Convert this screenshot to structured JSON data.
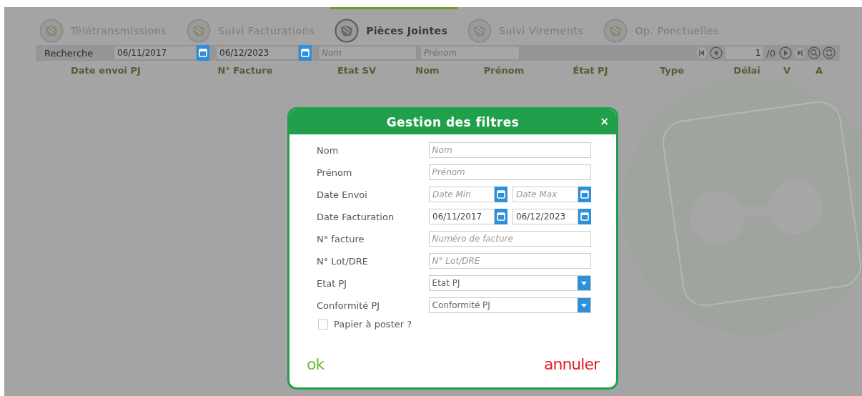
{
  "tabs": [
    {
      "label": "Télétransmissions",
      "selected": false
    },
    {
      "label": "Suivi Facturations",
      "selected": false
    },
    {
      "label": "Pièces Jointes",
      "selected": true
    },
    {
      "label": "Suivi Virements",
      "selected": false
    },
    {
      "label": "Op. Ponctuelles",
      "selected": false
    }
  ],
  "search_bar": {
    "label": "Recherche",
    "date_from": "06/11/2017",
    "date_to": "06/12/2023",
    "name_placeholder": "Nom",
    "firstname_placeholder": "Prénom",
    "page": "1",
    "page_total": "/0"
  },
  "table": {
    "columns": [
      "Date envoi PJ",
      "N° Facture",
      "Etat SV",
      "Nom",
      "Prénom",
      "État PJ",
      "Type",
      "Délai",
      "V",
      "A"
    ]
  },
  "dialog": {
    "title": "Gestion des filtres",
    "close": "×",
    "fields": [
      {
        "kind": "text",
        "label": "Nom",
        "placeholder": "Nom"
      },
      {
        "kind": "text",
        "label": "Prénom",
        "placeholder": "Prénom"
      },
      {
        "kind": "daterange",
        "label": "Date Envoi",
        "from": {
          "placeholder": "Date Min"
        },
        "to": {
          "placeholder": "Date Max"
        }
      },
      {
        "kind": "daterange",
        "label": "Date Facturation",
        "from": {
          "value": "06/11/2017"
        },
        "to": {
          "value": "06/12/2023"
        }
      },
      {
        "kind": "text",
        "label": "N° facture",
        "placeholder": "Numéro de facture"
      },
      {
        "kind": "text",
        "label": "N° Lot/DRE",
        "placeholder": "N° Lot/DRE"
      },
      {
        "kind": "select",
        "label": "Etat PJ",
        "value": "Etat PJ"
      },
      {
        "kind": "select",
        "label": "Conformité PJ",
        "value": "Conformité PJ"
      }
    ],
    "checkbox": {
      "label": "Papier à poster ?",
      "checked": false
    },
    "ok": "ok",
    "cancel": "annuler"
  }
}
